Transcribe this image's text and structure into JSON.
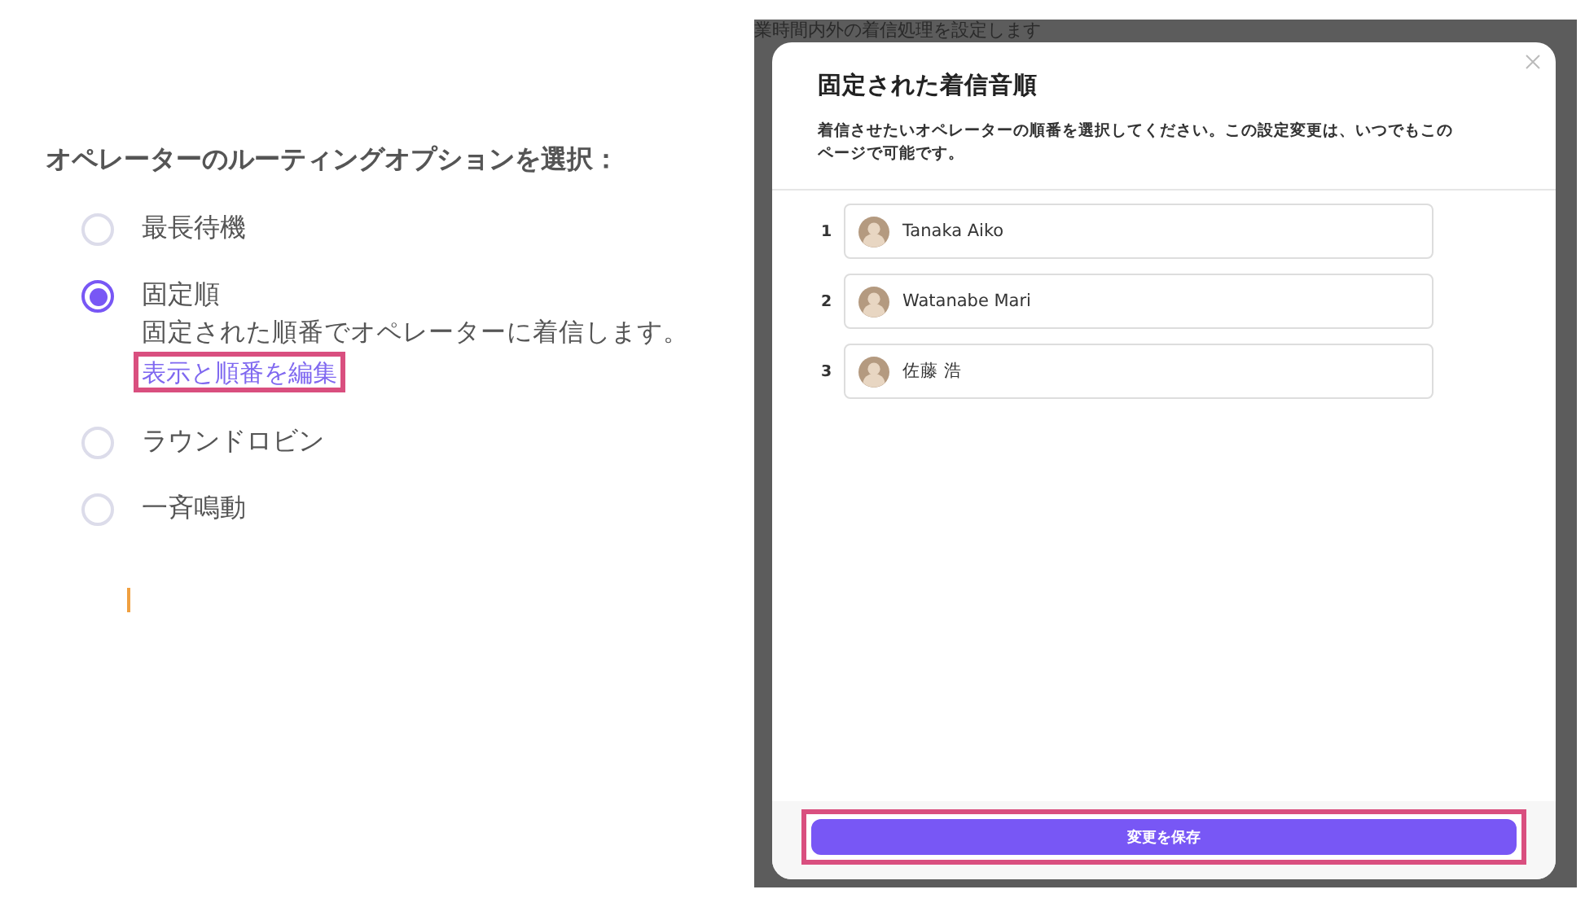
{
  "routing_panel": {
    "heading": "オペレーターのルーティングオプションを選択：",
    "options": [
      {
        "label": "最長待機",
        "selected": false
      },
      {
        "label": "固定順",
        "selected": true,
        "description": "固定された順番でオペレーターに着信します。",
        "link": "表示と順番を編集"
      },
      {
        "label": "ラウンドロビン",
        "selected": false
      },
      {
        "label": "一斉鳴動",
        "selected": false
      }
    ]
  },
  "modal": {
    "background_text": "業時間内外の着信処理を設定します",
    "title": "固定された着信音順",
    "description": "着信させたいオペレーターの順番を選択してください。この設定変更は、いつでもこのページで可能です。",
    "operators": [
      {
        "number": "1",
        "name": "Tanaka Aiko"
      },
      {
        "number": "2",
        "name": "Watanabe Mari"
      },
      {
        "number": "3",
        "name": "佐藤 浩"
      }
    ],
    "save_button": "変更を保存"
  }
}
